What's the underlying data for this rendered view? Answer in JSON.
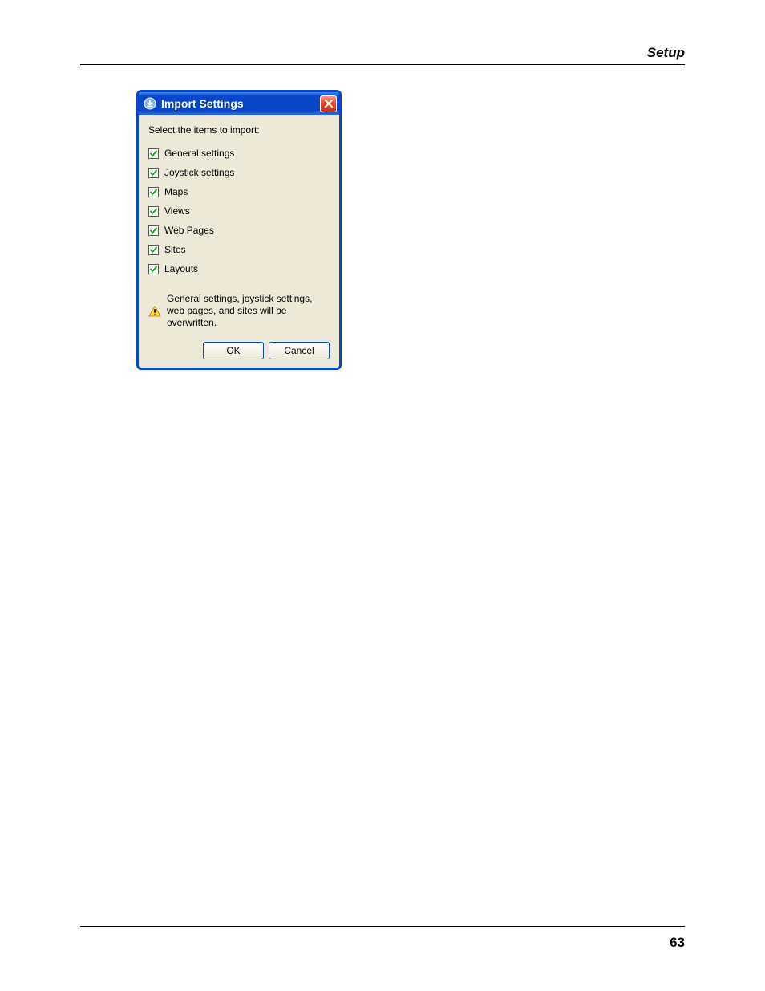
{
  "header": {
    "section": "Setup"
  },
  "footer": {
    "page_number": "63"
  },
  "dialog": {
    "title": "Import Settings",
    "prompt": "Select the items to import:",
    "items": [
      {
        "label": "General settings",
        "checked": true
      },
      {
        "label": "Joystick settings",
        "checked": true
      },
      {
        "label": "Maps",
        "checked": true
      },
      {
        "label": "Views",
        "checked": true
      },
      {
        "label": "Web Pages",
        "checked": true
      },
      {
        "label": "Sites",
        "checked": true
      },
      {
        "label": "Layouts",
        "checked": true
      }
    ],
    "warning": "General settings, joystick settings, web pages, and sites will be overwritten.",
    "buttons": {
      "ok": {
        "hotkey": "O",
        "rest": "K"
      },
      "cancel": {
        "hotkey": "C",
        "rest": "ancel"
      }
    }
  }
}
